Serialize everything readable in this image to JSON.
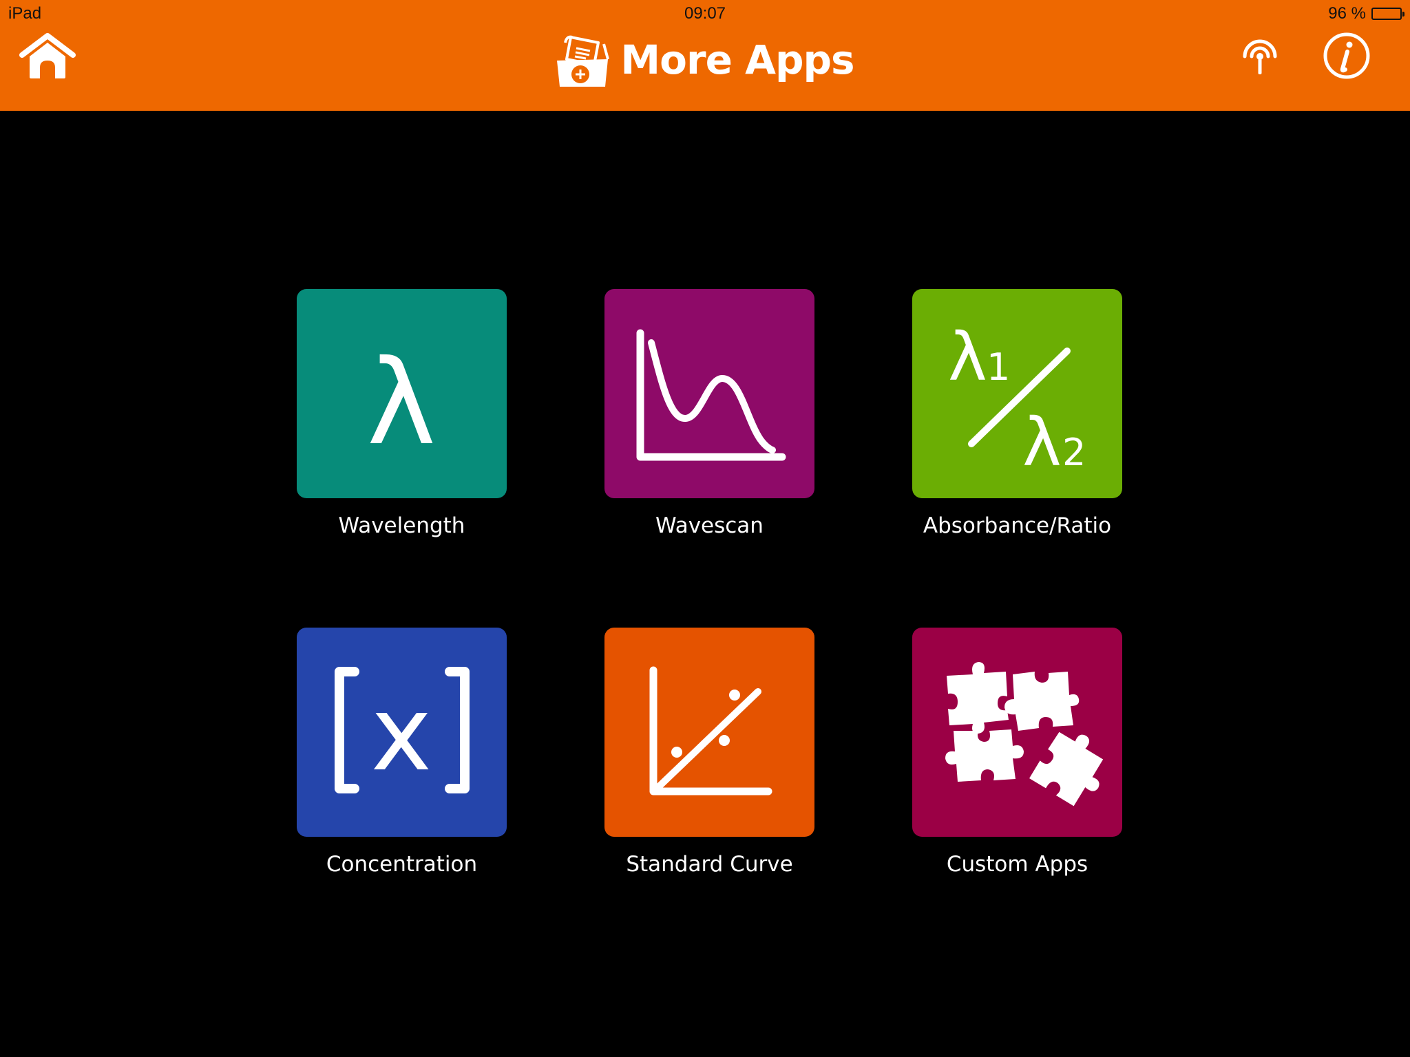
{
  "status_bar": {
    "device": "iPad",
    "time": "09:07",
    "battery_text": "96 %",
    "battery_level": 0.96
  },
  "header": {
    "title": "More Apps",
    "title_icon": "folder-add-icon",
    "home_icon": "home-icon",
    "antenna_icon": "antenna-icon",
    "info_icon": "info-icon",
    "background_color": "#EE6800"
  },
  "apps": [
    {
      "label": "Wavelength",
      "icon": "lambda-icon",
      "color": "#078C7A",
      "glyph": "λ"
    },
    {
      "label": "Wavescan",
      "icon": "wavescan-curve-icon",
      "color": "#8E0A68"
    },
    {
      "label": "Absorbance/Ratio",
      "icon": "lambda-ratio-icon",
      "color": "#6BAE04",
      "glyph_top": "λ",
      "sub_top": "1",
      "glyph_bottom": "λ",
      "sub_bottom": "2"
    },
    {
      "label": "Concentration",
      "icon": "bracket-x-icon",
      "color": "#2545AB",
      "glyph": "x"
    },
    {
      "label": "Standard Curve",
      "icon": "standard-curve-icon",
      "color": "#E55300"
    },
    {
      "label": "Custom Apps",
      "icon": "puzzle-pieces-icon",
      "color": "#9B0045"
    }
  ]
}
